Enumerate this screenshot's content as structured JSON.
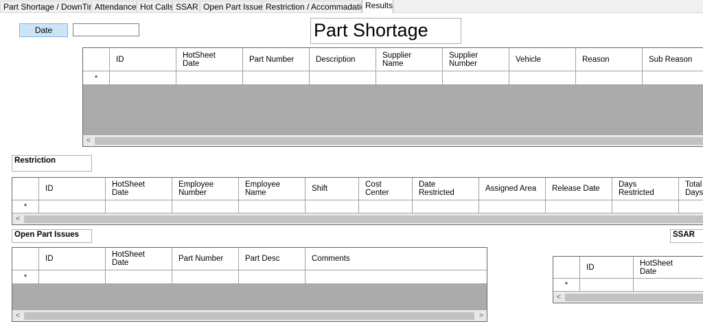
{
  "tabs": [
    {
      "label": "Part Shortage / DownTime"
    },
    {
      "label": "Attendance"
    },
    {
      "label": "Hot Calls"
    },
    {
      "label": "SSAR"
    },
    {
      "label": "Open Part Issues"
    },
    {
      "label": "Restriction / Accommadation"
    },
    {
      "label": "Results"
    }
  ],
  "filter": {
    "date_button": "Date",
    "date_value": ""
  },
  "title": "Part Shortage",
  "part_shortage_grid": {
    "columns": [
      "ID",
      "HotSheet\nDate",
      "Part Number",
      "Description",
      "Supplier\nName",
      "Supplier\nNumber",
      "Vehicle",
      "Reason",
      "Sub Reason"
    ],
    "new_row_marker": "*"
  },
  "restriction": {
    "label": "Restriction",
    "columns": [
      "ID",
      "HotSheet\nDate",
      "Employee\nNumber",
      "Employee\nName",
      "Shift",
      "Cost\nCenter",
      "Date\nRestricted",
      "Assigned Area",
      "Release Date",
      "Days\nRestricted",
      "Total\nDays"
    ],
    "new_row_marker": "*"
  },
  "open_part_issues": {
    "label": "Open Part Issues",
    "columns": [
      "ID",
      "HotSheet\nDate",
      "Part Number",
      "Part Desc",
      "Comments"
    ],
    "new_row_marker": "*"
  },
  "ssar": {
    "label": "SSAR",
    "columns": [
      "ID",
      "HotSheet\nDate"
    ],
    "new_row_marker": "*"
  },
  "scroll_arrows": {
    "left": "<",
    "right": ">"
  }
}
